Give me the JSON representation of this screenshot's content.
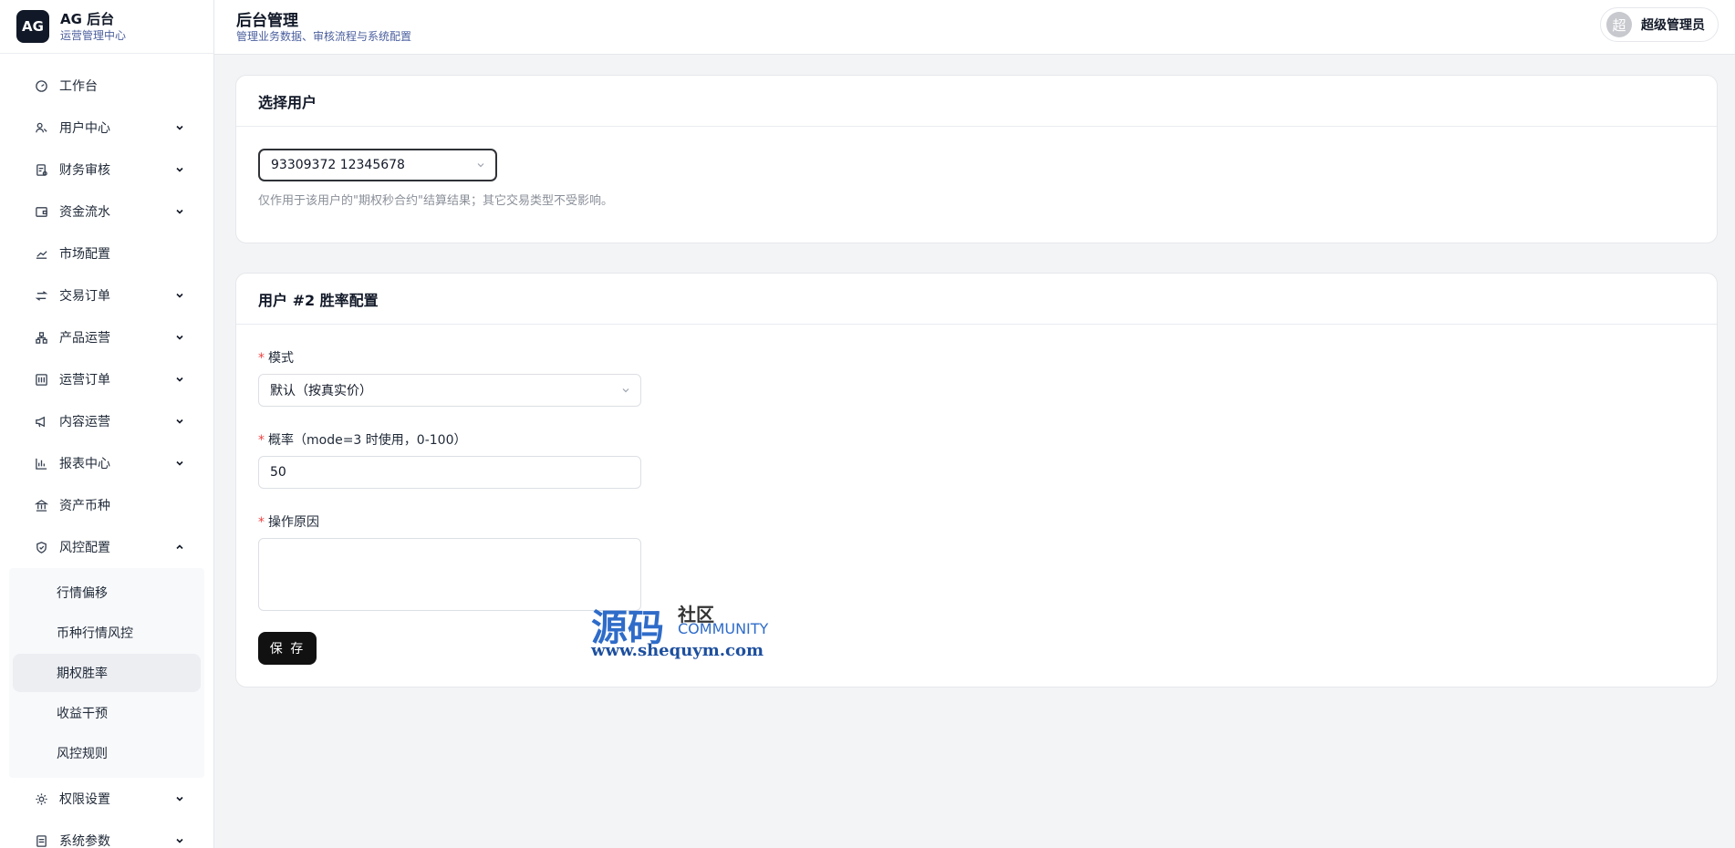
{
  "brand": {
    "logo": "AG",
    "title": "AG 后台",
    "subtitle": "运营管理中心"
  },
  "header": {
    "title": "后台管理",
    "subtitle": "管理业务数据、审核流程与系统配置"
  },
  "user": {
    "avatar": "超",
    "name": "超级管理员"
  },
  "sidebar": {
    "items": [
      {
        "label": "工作台",
        "icon": "dashboard-icon",
        "expandable": false
      },
      {
        "label": "用户中心",
        "icon": "users-icon",
        "expandable": true
      },
      {
        "label": "财务审核",
        "icon": "audit-icon",
        "expandable": true
      },
      {
        "label": "资金流水",
        "icon": "wallet-icon",
        "expandable": true
      },
      {
        "label": "市场配置",
        "icon": "trend-icon",
        "expandable": false
      },
      {
        "label": "交易订单",
        "icon": "swap-icon",
        "expandable": true
      },
      {
        "label": "产品运营",
        "icon": "boxes-icon",
        "expandable": true
      },
      {
        "label": "运营订单",
        "icon": "sliders-icon",
        "expandable": true
      },
      {
        "label": "内容运营",
        "icon": "megaphone-icon",
        "expandable": true
      },
      {
        "label": "报表中心",
        "icon": "bar-chart-icon",
        "expandable": true
      },
      {
        "label": "资产币种",
        "icon": "bank-icon",
        "expandable": false
      },
      {
        "label": "风控配置",
        "icon": "shield-icon",
        "expandable": true,
        "expanded": true
      }
    ],
    "risk_submenu": [
      "行情偏移",
      "币种行情风控",
      "期权胜率",
      "收益干预",
      "风控规则"
    ],
    "active_sub": "期权胜率",
    "after_items": [
      {
        "label": "权限设置",
        "icon": "gear-icon",
        "expandable": true
      },
      {
        "label": "系统参数",
        "icon": "settings-doc-icon",
        "expandable": true
      }
    ]
  },
  "select_user_card": {
    "title": "选择用户",
    "selected_user": "93309372 12345678",
    "hint": "仅作用于该用户的\"期权秒合约\"结算结果；其它交易类型不受影响。"
  },
  "config_card": {
    "title": "用户 #2 胜率配置",
    "mode_label": "模式",
    "mode_value": "默认（按真实价）",
    "prob_label": "概率（mode=3 时使用，0-100）",
    "prob_value": "50",
    "reason_label": "操作原因",
    "reason_value": "",
    "save_label": "保 存",
    "required_mark": "*"
  },
  "watermark": {
    "cn": "源码",
    "she": "社区",
    "en": "COMMUNITY",
    "url": "www.shequym.com"
  },
  "colors": {
    "accent": "#111111",
    "required": "#ef4444",
    "subtitle": "#4b5f9e"
  }
}
